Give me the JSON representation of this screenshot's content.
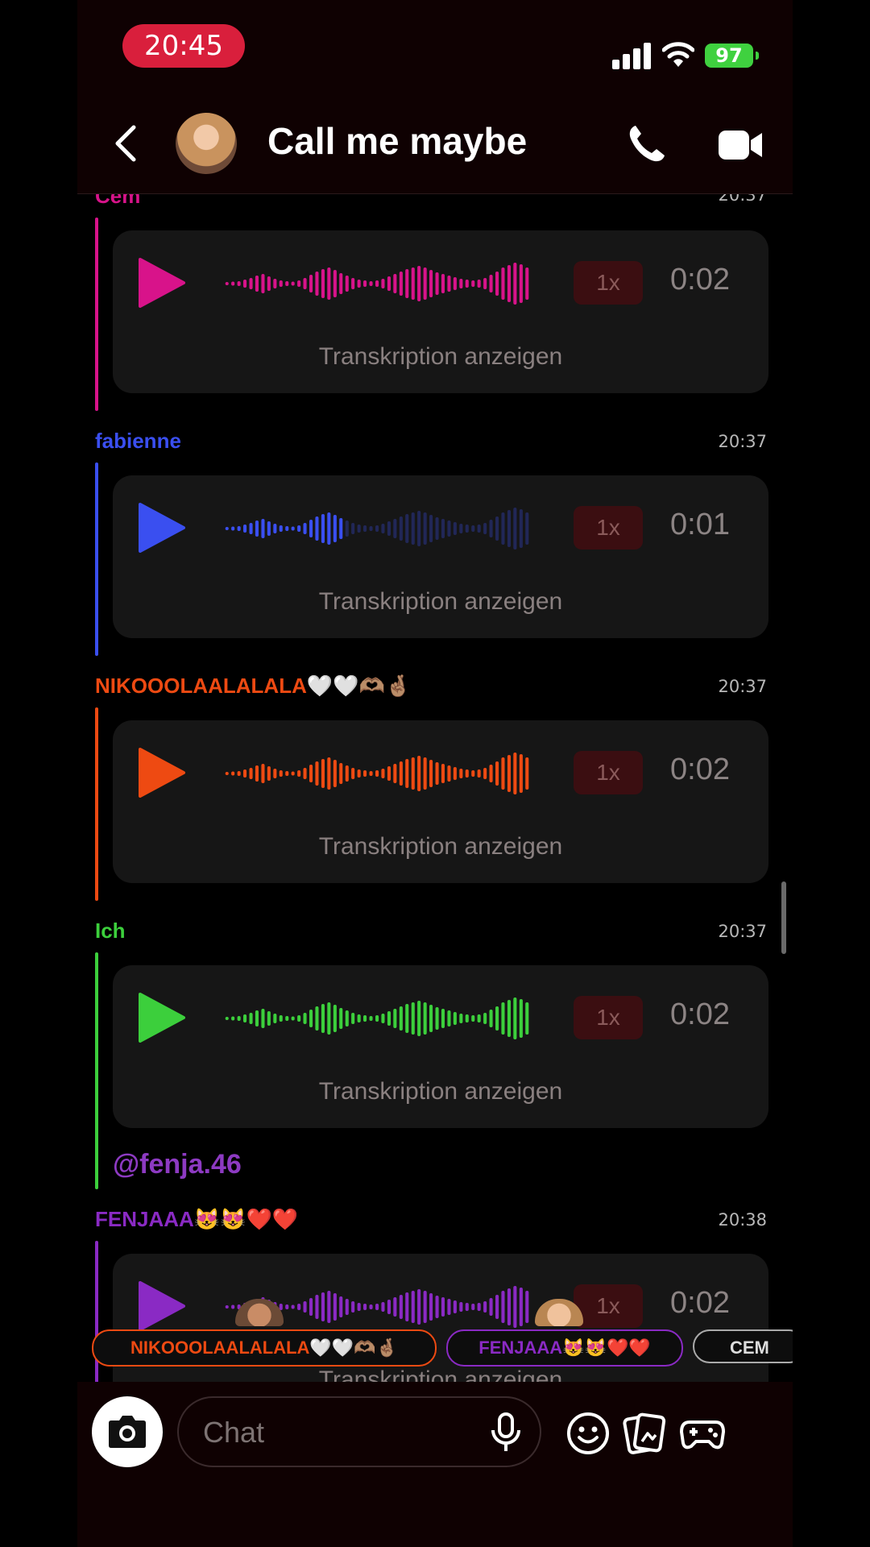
{
  "status_bar": {
    "time": "20:45",
    "battery": "97"
  },
  "header": {
    "title": "Call me maybe"
  },
  "messages": [
    {
      "sender": "Cem",
      "time": "20:37",
      "speed": "1x",
      "duration": "0:02",
      "transcribe": "Transkription anzeigen",
      "color": "#d8138a",
      "played_fraction": 1.0
    },
    {
      "sender": "fabienne",
      "time": "20:37",
      "speed": "1x",
      "duration": "0:01",
      "transcribe": "Transkription anzeigen",
      "color": "#3a4ff0",
      "played_fraction": 0.38
    },
    {
      "sender": "NIKOOOLAALALALA🤍🤍🫶🏽🤞🏽",
      "time": "20:37",
      "speed": "1x",
      "duration": "0:02",
      "transcribe": "Transkription anzeigen",
      "color": "#ee4a12",
      "played_fraction": 1.0
    },
    {
      "sender": "Ich",
      "time": "20:37",
      "speed": "1x",
      "duration": "0:02",
      "transcribe": "Transkription anzeigen",
      "color": "#3ccf3c",
      "played_fraction": 1.0,
      "mention": "@fenja.46"
    },
    {
      "sender": "FENJAAA😻😻❤️❤️",
      "time": "20:38",
      "speed": "1x",
      "duration": "0:02",
      "transcribe": "Transkription anzeigen",
      "color": "#8a2ac4",
      "played_fraction": 1.0
    }
  ],
  "typing_chips": [
    {
      "label": "NIKOOOLAALALALA🤍🤍🫶🏽🤞🏽",
      "color": "#ee4a12"
    },
    {
      "label": "FENJAAA😻😻❤️❤️",
      "color": "#8a2ac4"
    },
    {
      "label": "CEM",
      "color": "#dddddd"
    }
  ],
  "composer": {
    "placeholder": "Chat"
  },
  "icons": {
    "back": "chevron-left-icon",
    "call": "phone-icon",
    "video": "video-camera-icon",
    "camera": "camera-icon",
    "mic": "microphone-icon",
    "emoji": "smiley-icon",
    "memories": "photo-cards-icon",
    "games": "game-controller-icon"
  }
}
